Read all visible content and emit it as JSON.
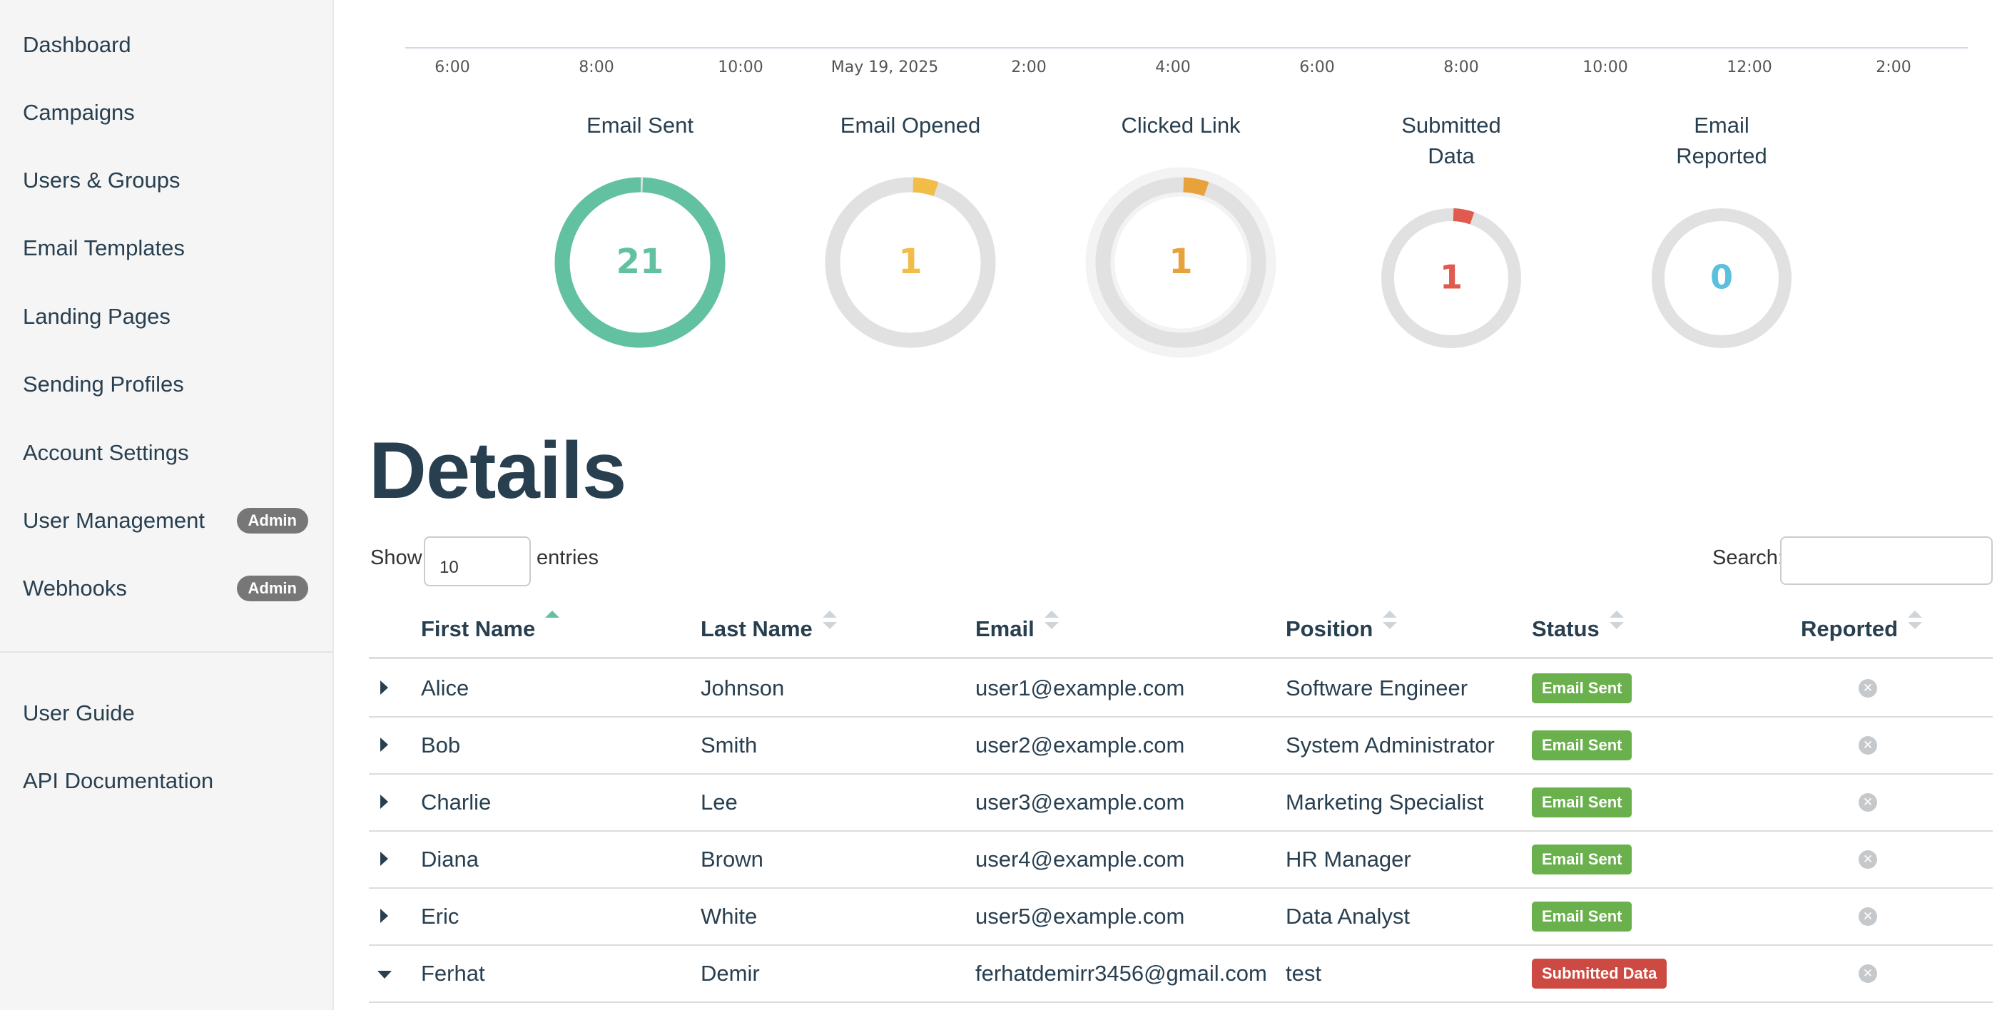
{
  "sidebar": {
    "items": [
      {
        "label": "Dashboard"
      },
      {
        "label": "Campaigns"
      },
      {
        "label": "Users & Groups"
      },
      {
        "label": "Email Templates"
      },
      {
        "label": "Landing Pages"
      },
      {
        "label": "Sending Profiles"
      },
      {
        "label": "Account Settings"
      },
      {
        "label": "User Management",
        "badge": "Admin"
      },
      {
        "label": "Webhooks",
        "badge": "Admin"
      }
    ],
    "secondary": [
      {
        "label": "User Guide"
      },
      {
        "label": "API Documentation"
      }
    ]
  },
  "timeline": {
    "ticks": [
      "6:00",
      "8:00",
      "10:00",
      "May 19, 2025",
      "2:00",
      "4:00",
      "6:00",
      "8:00",
      "10:00",
      "12:00",
      "2:00"
    ]
  },
  "stats": [
    {
      "title": "Email Sent",
      "value": "21",
      "fraction": 1.0,
      "color": "#62c1a1",
      "icon": "email-sent"
    },
    {
      "title": "Email Opened",
      "value": "1",
      "fraction": 0.048,
      "color": "#f2bd47",
      "icon": "email-opened"
    },
    {
      "title": "Clicked Link",
      "value": "1",
      "fraction": 0.048,
      "color": "#e8a23c",
      "icon": "clicked-link"
    },
    {
      "title": "Submitted\nData",
      "value": "1",
      "fraction": 0.048,
      "color": "#e05a4f",
      "icon": "submitted-data"
    },
    {
      "title": "Email\nReported",
      "value": "0",
      "fraction": 0,
      "color": "#5bc0de",
      "icon": "email-reported"
    }
  ],
  "details": {
    "title": "Details",
    "show_label": "Show",
    "entries_value": "10",
    "entries_label": "entries",
    "search_label": "Search:",
    "search_value": "",
    "columns": [
      "First Name",
      "Last Name",
      "Email",
      "Position",
      "Status",
      "Reported"
    ],
    "rows": [
      {
        "first": "Alice",
        "last": "Johnson",
        "email": "user1@example.com",
        "position": "Software Engineer",
        "status": "Email Sent",
        "status_color": "#6ab04c",
        "expanded": false
      },
      {
        "first": "Bob",
        "last": "Smith",
        "email": "user2@example.com",
        "position": "System Administrator",
        "status": "Email Sent",
        "status_color": "#6ab04c",
        "expanded": false
      },
      {
        "first": "Charlie",
        "last": "Lee",
        "email": "user3@example.com",
        "position": "Marketing Specialist",
        "status": "Email Sent",
        "status_color": "#6ab04c",
        "expanded": false
      },
      {
        "first": "Diana",
        "last": "Brown",
        "email": "user4@example.com",
        "position": "HR Manager",
        "status": "Email Sent",
        "status_color": "#6ab04c",
        "expanded": false
      },
      {
        "first": "Eric",
        "last": "White",
        "email": "user5@example.com",
        "position": "Data Analyst",
        "status": "Email Sent",
        "status_color": "#6ab04c",
        "expanded": false
      },
      {
        "first": "Ferhat",
        "last": "Demir",
        "email": "ferhatdemirr3456@gmail.com",
        "position": "test",
        "status": "Submitted Data",
        "status_color": "#cd4a42",
        "expanded": true
      }
    ]
  }
}
